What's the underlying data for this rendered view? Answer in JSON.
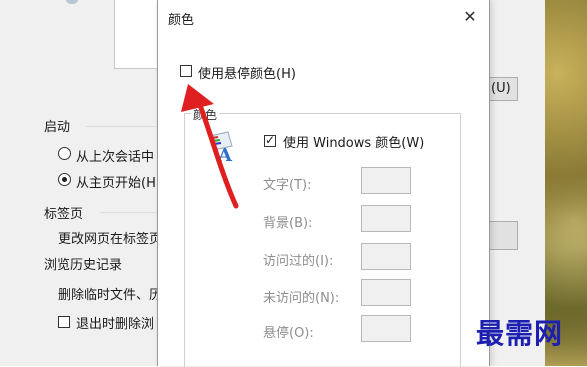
{
  "background_window": {
    "startup_heading": "启动",
    "radio_continue": "从上次会话中",
    "radio_home": "从主页开始(H",
    "tabs_heading": "标签页",
    "tabs_desc": "更改网页在标签页",
    "history_heading": "浏览历史记录",
    "history_desc": "删除临时文件、历",
    "delete_on_exit": "退出时删除浏",
    "button_partial": "(U)"
  },
  "dialog": {
    "title": "颜色",
    "close": "✕",
    "use_hover_color": "使用悬停颜色(H)",
    "group_legend": "颜色",
    "use_windows_colors": "使用 Windows 颜色(W)",
    "color_rows": [
      {
        "label": "文字(T):"
      },
      {
        "label": "背景(B):"
      },
      {
        "label": "访问过的(I):"
      },
      {
        "label": "未访问的(N):"
      },
      {
        "label": "悬停(O):"
      }
    ]
  },
  "watermark": "最需网",
  "colors": {
    "arrow": "#e02020",
    "watermark": "#1c1fb0"
  }
}
